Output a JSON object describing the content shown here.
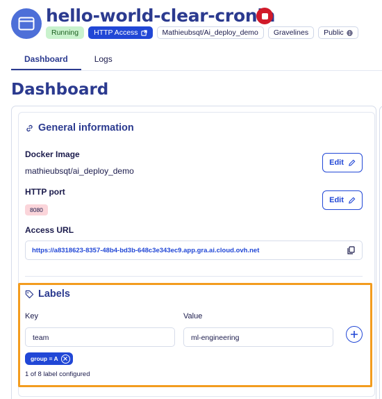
{
  "app": {
    "title": "hello-world-clear-cronin",
    "icon": "app-window-icon",
    "stop_icon": "stop-icon"
  },
  "badges": {
    "status": "Running",
    "http_access": "HTTP Access",
    "image": "Mathieubsqt/Ai_deploy_demo",
    "region": "Gravelines",
    "visibility": "Public"
  },
  "tabs": [
    {
      "label": "Dashboard",
      "active": true
    },
    {
      "label": "Logs",
      "active": false
    }
  ],
  "page_title": "Dashboard",
  "general": {
    "heading": "General information",
    "docker_label": "Docker Image",
    "docker_value": "mathieubsqt/ai_deploy_demo",
    "port_label": "HTTP port",
    "port_value": "8080",
    "edit_label": "Edit",
    "url_label": "Access URL",
    "url_value": "https://a8318623-8357-48b4-bd3b-648c3e343ec9.app.gra.ai.cloud.ovh.net"
  },
  "labels": {
    "heading": "Labels",
    "key_label": "Key",
    "value_label": "Value",
    "key_input": "team",
    "value_input": "ml-engineering",
    "chip": "group = A",
    "count": "1 of 8 label configured"
  },
  "colors": {
    "brand": "#2147d6",
    "title": "#2b3a8f",
    "stop": "#d11a2a",
    "running": "#c9f2cd",
    "port_chip": "#fbd5da",
    "highlight": "#f39c1f"
  }
}
